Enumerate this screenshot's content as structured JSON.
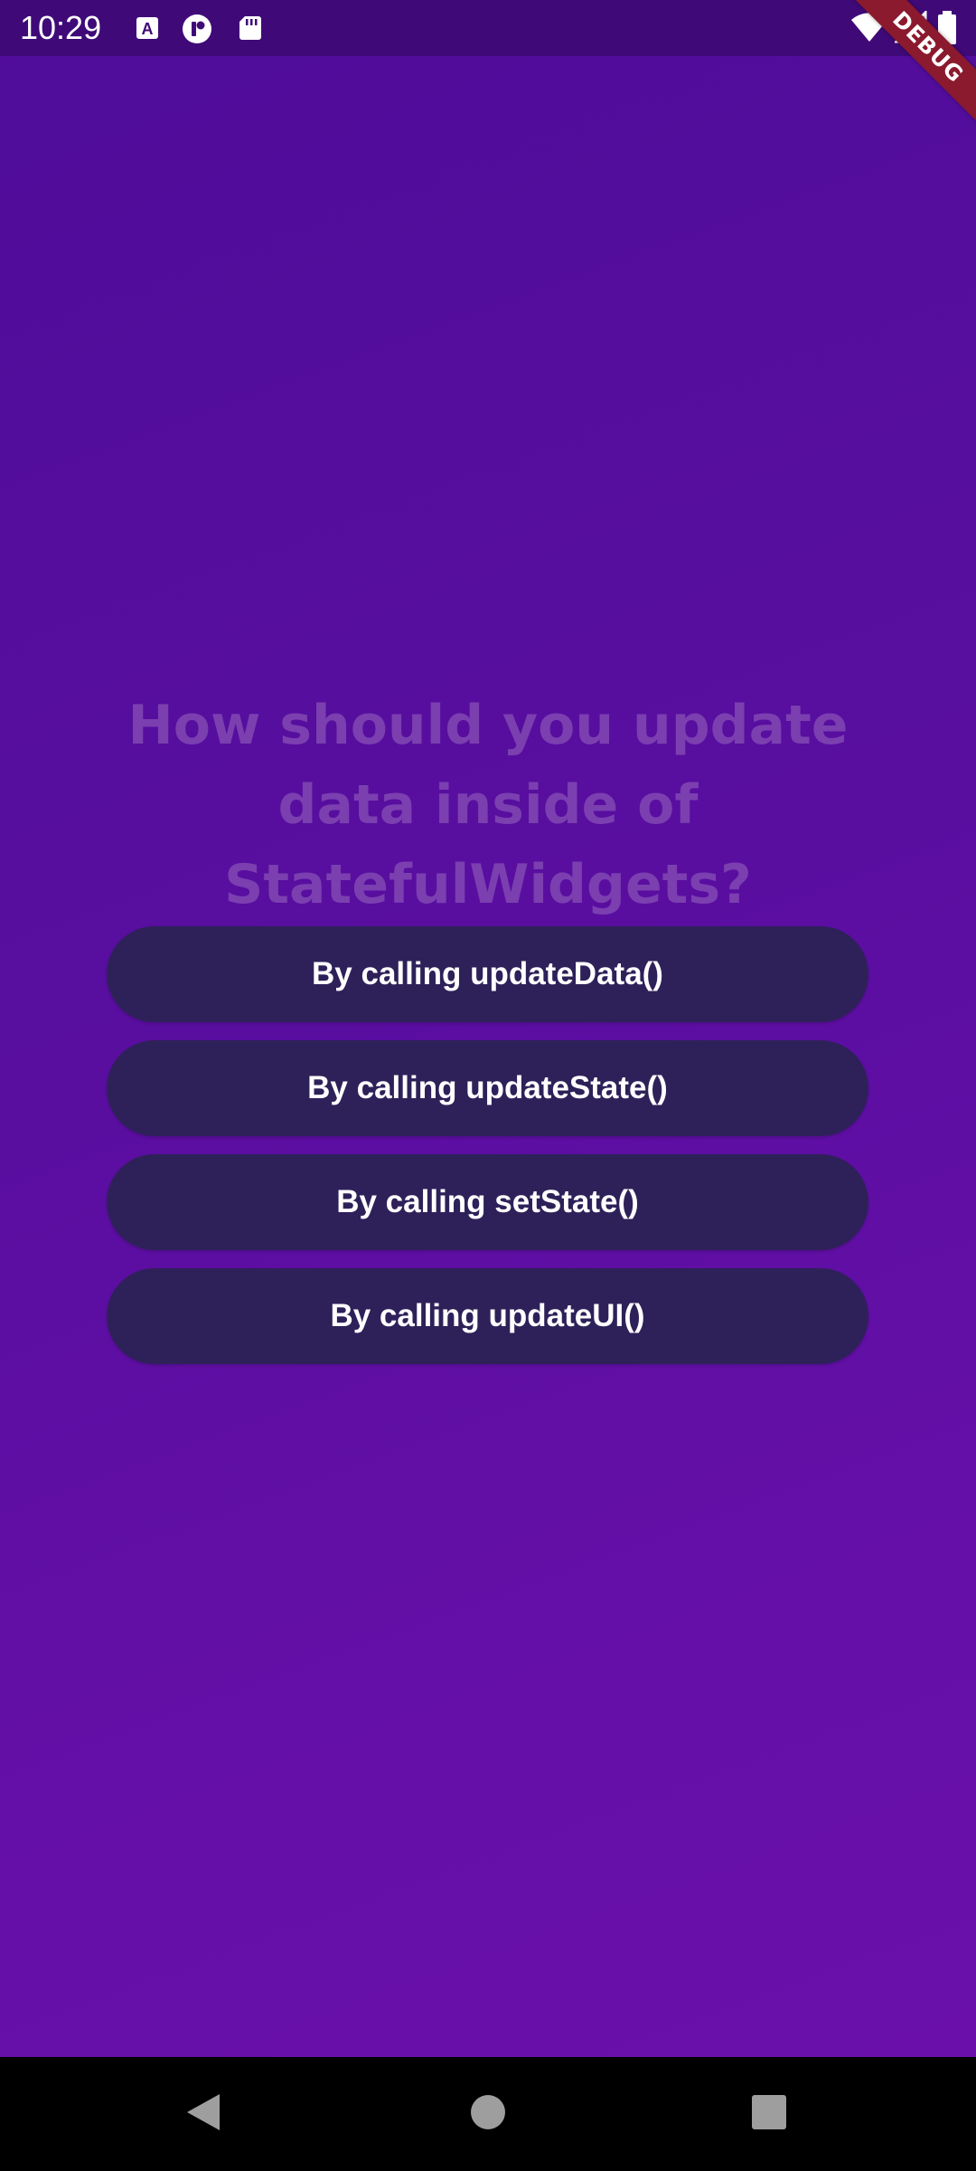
{
  "status_bar": {
    "time": "10:29",
    "left_icons": [
      "text-a-icon",
      "record-icon",
      "sd-card-icon"
    ],
    "right_icons": [
      "wifi-icon",
      "signal-icon",
      "battery-icon"
    ]
  },
  "debug_banner": {
    "label": "DEBUG"
  },
  "quiz": {
    "question": "How should you update data inside of StatefulWidgets?",
    "answers": [
      {
        "label": "By calling updateData()"
      },
      {
        "label": "By calling updateState()"
      },
      {
        "label": "By calling setState()"
      },
      {
        "label": "By calling updateUI()"
      }
    ]
  },
  "nav_bar": {
    "buttons": [
      "back-icon",
      "home-icon",
      "recents-icon"
    ]
  },
  "colors": {
    "background_start": "#4f0c99",
    "background_end": "#6b0fab",
    "question_text": "#7b3fb0",
    "button_background": "#2e2159",
    "button_text": "#ffffff",
    "debug_banner": "#8b1a2e"
  }
}
